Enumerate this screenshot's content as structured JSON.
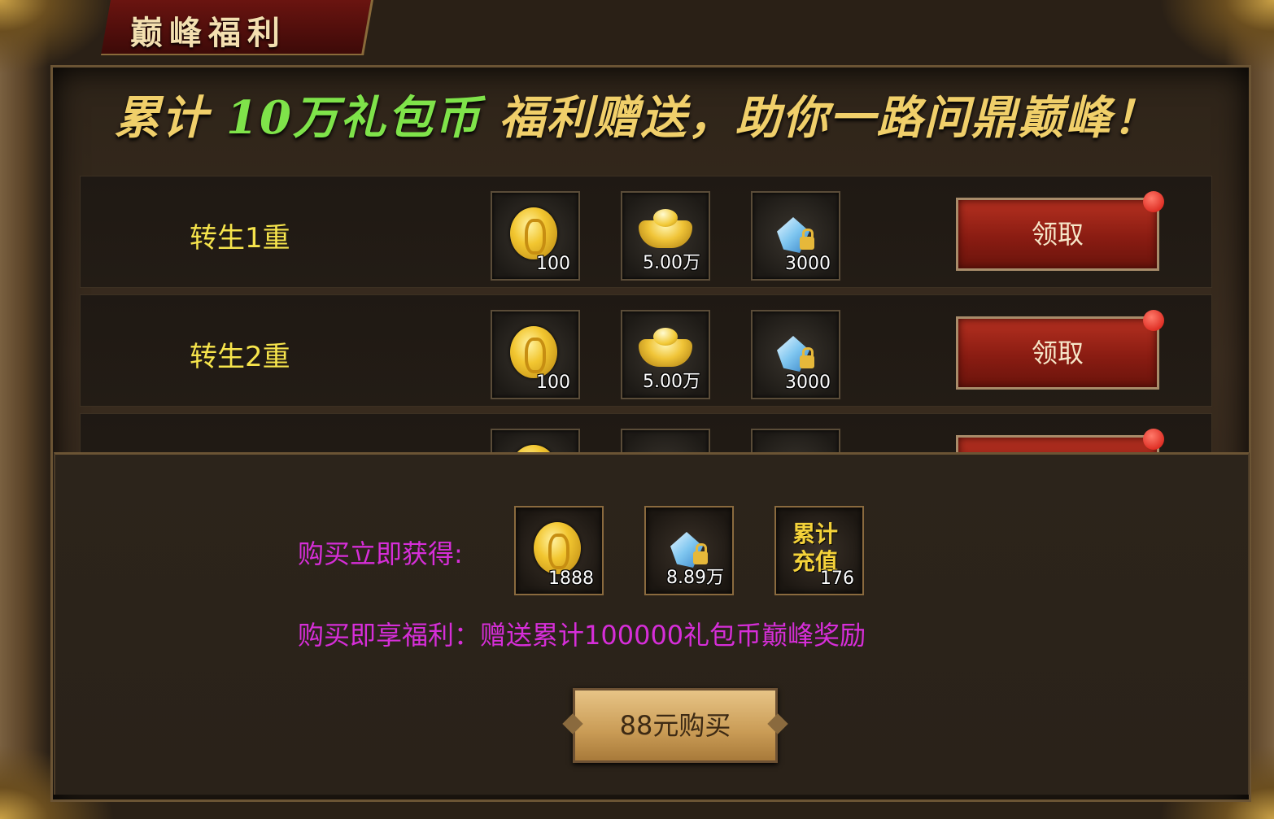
{
  "window": {
    "title": "巅峰福利"
  },
  "banner": {
    "part1": "累计 ",
    "highlight": "10万礼包币",
    "part2": " 福利赠送，助你一路问鼎巅峰！"
  },
  "rows": [
    {
      "label": "转生1重",
      "items": [
        {
          "icon": "gold-coin-icon",
          "count": "100"
        },
        {
          "icon": "gold-ingot-icon",
          "count": "5.00万"
        },
        {
          "icon": "locked-gem-icon",
          "count": "3000"
        }
      ],
      "button": "领取",
      "has_notification": true
    },
    {
      "label": "转生2重",
      "items": [
        {
          "icon": "gold-coin-icon",
          "count": "100"
        },
        {
          "icon": "gold-ingot-icon",
          "count": "5.00万"
        },
        {
          "icon": "locked-gem-icon",
          "count": "3000"
        }
      ],
      "button": "领取",
      "has_notification": true
    },
    {
      "label": "",
      "items": [
        {
          "icon": "gold-coin-icon",
          "count": ""
        },
        {
          "icon": "gold-ingot-icon",
          "count": ""
        },
        {
          "icon": "locked-gem-icon",
          "count": ""
        }
      ],
      "button": "",
      "has_notification": true
    }
  ],
  "purchase": {
    "label": "购买立即获得:",
    "items": [
      {
        "icon": "gold-coin-icon",
        "count": "1888"
      },
      {
        "icon": "locked-gem-icon",
        "count": "8.89万"
      },
      {
        "icon": "recharge-icon",
        "text": "累计充值",
        "count": "176"
      }
    ],
    "benefit": "购买即享福利：赠送累计100000礼包币巅峰奖励",
    "button": "88元购买"
  },
  "colors": {
    "slogan": "#f0cf6a",
    "slogan_highlight": "#7fe34a",
    "row_label": "#f6e44c",
    "purchase_text": "#d62ed8",
    "claim_button": "#9a2216",
    "buy_button": "#c99b55"
  }
}
